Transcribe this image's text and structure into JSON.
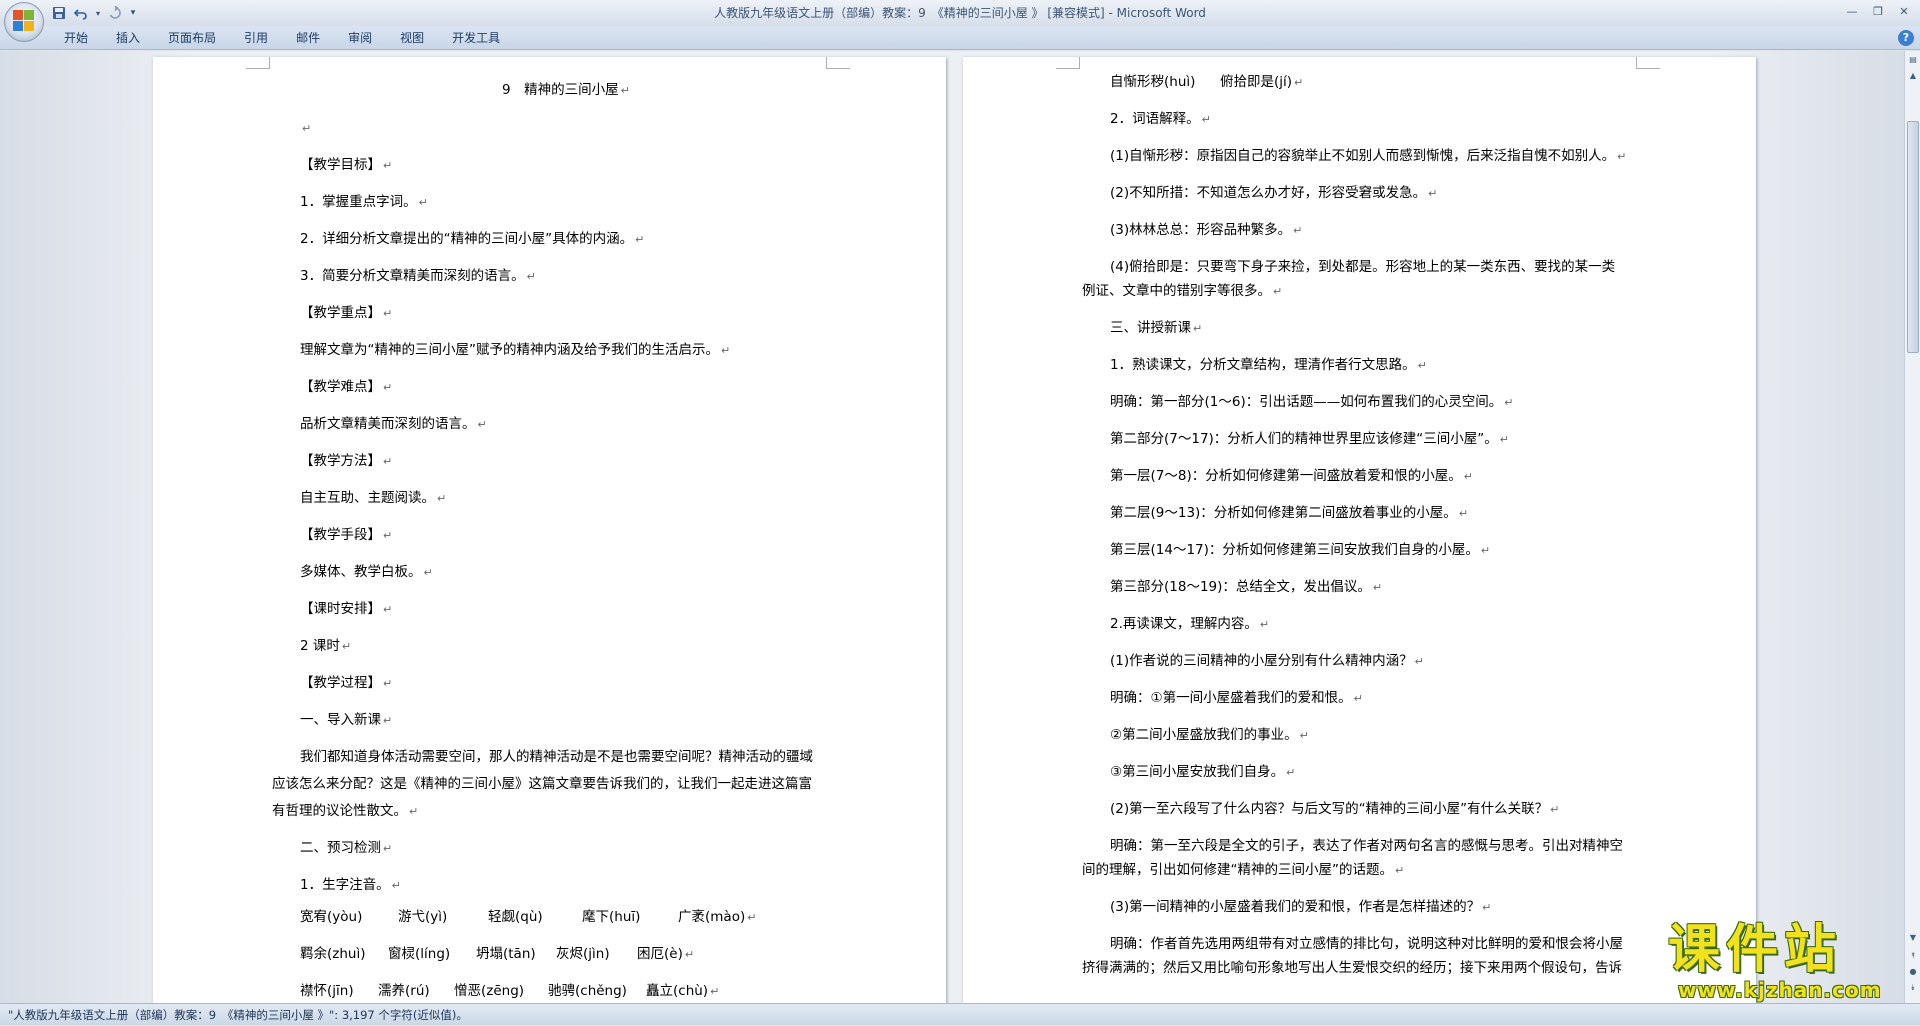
{
  "window": {
    "title": "人教版九年级语文上册（部编）教案：9　《精神的三间小屋 》 [兼容模式] - Microsoft Word",
    "controls": [
      "minimize-icon",
      "restore-icon",
      "close-icon"
    ]
  },
  "quick_access": [
    "save-icon",
    "undo-icon",
    "redo-icon",
    "customize-icon"
  ],
  "ribbon": {
    "tabs": [
      "开始",
      "插入",
      "页面布局",
      "引用",
      "邮件",
      "审阅",
      "视图",
      "开发工具"
    ],
    "help": "?"
  },
  "pilcrow": "↵",
  "left_page": {
    "title": "9　精神的三间小屋",
    "paragraphs": [
      "",
      "【教学目标】",
      "1．掌握重点字词。",
      "2．详细分析文章提出的“精神的三间小屋”具体的内涵。",
      "3．简要分析文章精美而深刻的语言。",
      "【教学重点】",
      "理解文章为“精神的三间小屋”赋予的精神内涵及给予我们的生活启示。",
      "【教学难点】",
      "品析文章精美而深刻的语言。",
      "【教学方法】",
      "自主互助、主题阅读。",
      "【教学手段】",
      "多媒体、教学白板。",
      "【课时安排】",
      "2 课时",
      "【教学过程】",
      "一、导入新课"
    ],
    "intro_lines": [
      "我们都知道身体活动需要空间，那人的精神活动是不是也需要空间呢？精神活动的疆域",
      "应该怎么来分配？这是《精神的三间小屋》这篇文章要告诉我们的，让我们一起走进这篇富",
      "有哲理的议论性散文。"
    ],
    "section2": "二、预习检测",
    "sub1": "1．生字注音。",
    "pinyin_rows": [
      [
        "宽宥(yòu)",
        "游弋(yì)",
        "轻觑(qù)",
        "麾下(huī)",
        "广袤(mào)"
      ],
      [
        "羁余(zhuì)",
        "窗棂(líng)",
        "坍塌(tān)",
        "灰烬(jìn)",
        "困厄(è)"
      ],
      [
        "襟怀(jīn)",
        "濡养(rú)",
        "憎恶(zēng)",
        "驰骋(chěng)",
        "矗立(chù)"
      ]
    ]
  },
  "right_page": {
    "top_row": [
      "自惭形秽(huì)",
      "俯拾即是(jí)"
    ],
    "lines": [
      "2．词语解释。",
      "(1)自惭形秽：原指因自己的容貌举止不如别人而感到惭愧，后来泛指自愧不如别人。",
      "(2)不知所措：不知道怎么办才好，形容受窘或发急。",
      "(3)林林总总：形容品种繁多。",
      "(4)俯拾即是：只要弯下身子来捡，到处都是。形容地上的某一类东西、要找的某一类",
      "例证、文章中的错别字等很多。",
      "三、讲授新课",
      "1．熟读课文，分析文章结构，理清作者行文思路。",
      "明确：第一部分(1～6)：引出话题——如何布置我们的心灵空间。",
      "第二部分(7～17)：分析人们的精神世界里应该修建“三间小屋”。",
      "第一层(7～8)：分析如何修建第一间盛放着爱和恨的小屋。",
      "第二层(9～13)：分析如何修建第二间盛放着事业的小屋。",
      "第三层(14～17)：分析如何修建第三间安放我们自身的小屋。",
      "第三部分(18～19)：总结全文，发出倡议。",
      "2.再读课文，理解内容。",
      "(1)作者说的三间精神的小屋分别有什么精神内涵？",
      "明确：①第一间小屋盛着我们的爱和恨。",
      "②第二间小屋盛放我们的事业。",
      "③第三间小屋安放我们自身。",
      "(2)第一至六段写了什么内容？与后文写的“精神的三间小屋”有什么关联？",
      "明确：第一至六段是全文的引子，表达了作者对两句名言的感慨与思考。引出对精神空",
      "间的理解，引出如何修建“精神的三间小屋”的话题。",
      "(3)第一间精神的小屋盛着我们的爱和恨，作者是怎样描述的？",
      "明确：作者首先选用两组带有对立感情的排比句，说明这种对比鲜明的爱和恨会将小屋",
      "挤得满满的；然后又用比喻句形象地写出人生爱恨交织的经历；接下来用两个假设句，告诉"
    ]
  },
  "status": "\"人教版九年级语文上册（部编）教案：9　《精神的三间小屋 》\": 3,197 个字符(近似值)。",
  "watermark": {
    "big": "课件站",
    "small": "www.kjzhan.com"
  },
  "colors": {
    "ribbon": "#c9d6e8",
    "title_text": "#3d5574",
    "watermark_yellow": "#f2e21e",
    "watermark_outline": "#3a6a12"
  }
}
